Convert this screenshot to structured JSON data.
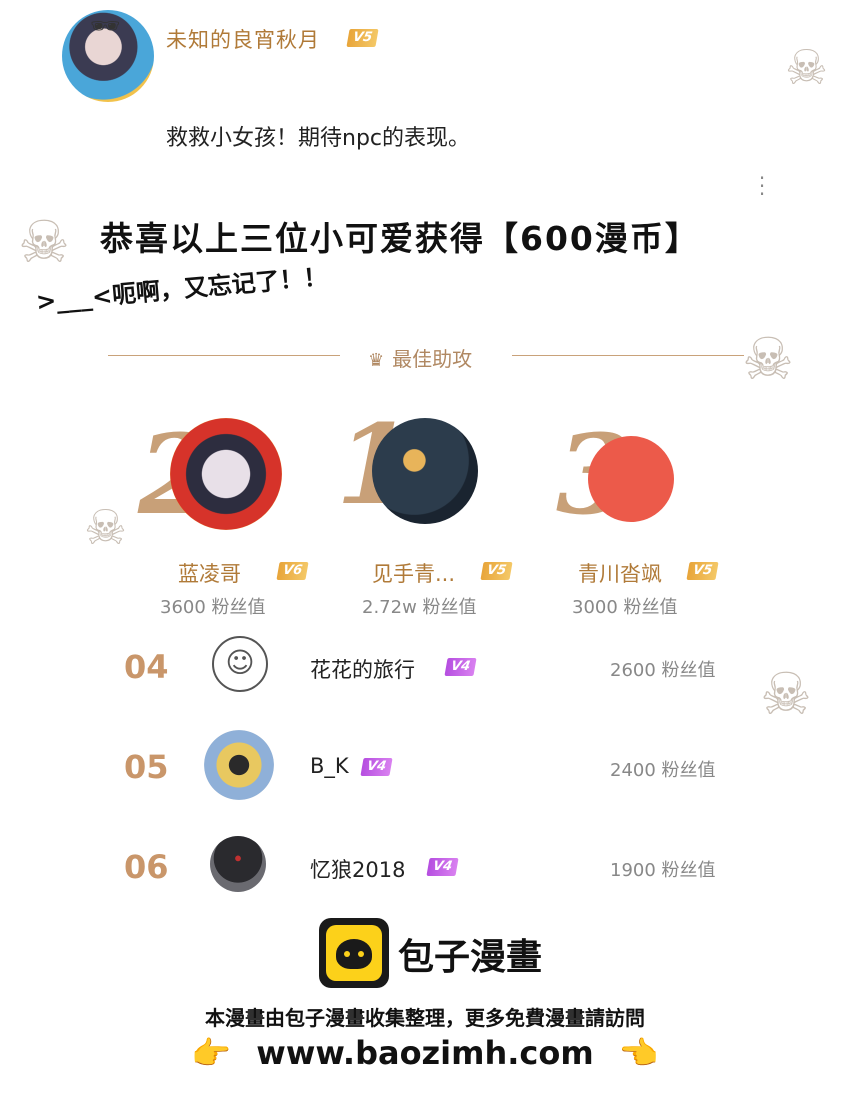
{
  "comment": {
    "username": "未知的良宵秋月",
    "level": "V5",
    "text": "救救小女孩！期待npc的表现。",
    "more_icon": "more-vertical-icon"
  },
  "announcement": {
    "headline": "恭喜以上三位小可爱获得【600漫币】",
    "subline": ">___<呃啊，又忘记了！！"
  },
  "section": {
    "title": "最佳助攻",
    "icon": "crown-icon"
  },
  "podium": [
    {
      "rank": "2",
      "name": "蓝凌哥",
      "level": "V6",
      "fans": "3600 粉丝值"
    },
    {
      "rank": "1",
      "name": "见手青...",
      "level": "V5",
      "fans": "2.72w 粉丝值"
    },
    {
      "rank": "3",
      "name": "青川沓飒",
      "level": "V5",
      "fans": "3000 粉丝值"
    }
  ],
  "list": [
    {
      "rank": "04",
      "name": "花花的旅行",
      "level": "V4",
      "fans": "2600 粉丝值"
    },
    {
      "rank": "05",
      "name": "B_K",
      "level": "V4",
      "fans": "2400 粉丝值"
    },
    {
      "rank": "06",
      "name": "忆狼2018",
      "level": "V4",
      "fans": "1900 粉丝值"
    }
  ],
  "footer": {
    "brand": "包子漫畫",
    "text": "本漫畫由包子漫畫收集整理，更多免費漫畫請訪問",
    "url": "www.baozimh.com",
    "hand_left": "👉",
    "hand_right": "👈"
  },
  "colors": {
    "accent_gold": "#b07a38",
    "rank_tan": "#c9966a",
    "level_gold": "#e8a53a",
    "level_purple": "#b54ee0",
    "brand_yellow": "#fcd11a"
  }
}
